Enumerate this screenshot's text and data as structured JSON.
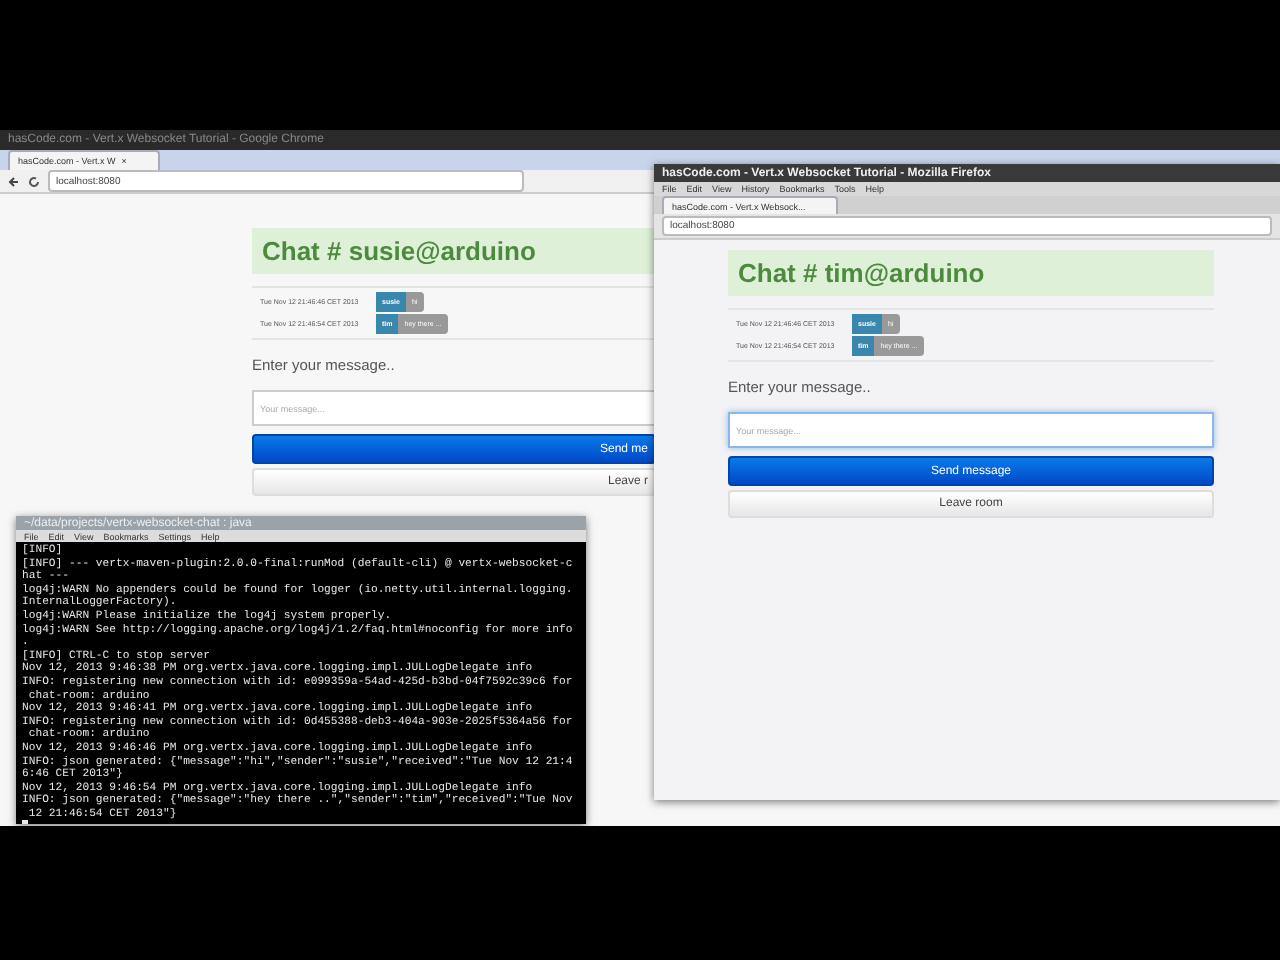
{
  "chrome_window": {
    "title": "hasCode.com - Vert.x Websocket Tutorial - Google Chrome",
    "tab": {
      "label": "hasCode.com - Vert.x W",
      "close": "×"
    },
    "address": "localhost:8080",
    "chat": {
      "heading": "Chat # susie@arduino",
      "messages": [
        {
          "time": "Tue Nov 12 21:46:46 CET 2013",
          "sender": "susie",
          "text": "hi"
        },
        {
          "time": "Tue Nov 12 21:46:54 CET 2013",
          "sender": "tim",
          "text": "hey there ..."
        }
      ],
      "prompt": "Enter your message..",
      "input": {
        "placeholder": "Your message..."
      },
      "send_button": "Send me",
      "leave_button": "Leave r"
    }
  },
  "terminal_window": {
    "title": "~/data/projects/vertx-websocket-chat : java",
    "menu": [
      "File",
      "Edit",
      "View",
      "Bookmarks",
      "Settings",
      "Help"
    ],
    "lines": [
      "[INFO]",
      "[INFO] --- vertx-maven-plugin:2.0.0-final:runMod (default-cli) @ vertx-websocket-c",
      "hat ---",
      "log4j:WARN No appenders could be found for logger (io.netty.util.internal.logging.",
      "InternalLoggerFactory).",
      "log4j:WARN Please initialize the log4j system properly.",
      "log4j:WARN See http://logging.apache.org/log4j/1.2/faq.html#noconfig for more info",
      ".",
      "[INFO] CTRL-C to stop server",
      "Nov 12, 2013 9:46:38 PM org.vertx.java.core.logging.impl.JULLogDelegate info",
      "INFO: registering new connection with id: e099359a-54ad-425d-b3bd-04f7592c39c6 for",
      " chat-room: arduino",
      "Nov 12, 2013 9:46:41 PM org.vertx.java.core.logging.impl.JULLogDelegate info",
      "INFO: registering new connection with id: 0d455388-deb3-404a-903e-2025f5364a56 for",
      " chat-room: arduino",
      "Nov 12, 2013 9:46:46 PM org.vertx.java.core.logging.impl.JULLogDelegate info",
      "INFO: json generated: {\"message\":\"hi\",\"sender\":\"susie\",\"received\":\"Tue Nov 12 21:4",
      "6:46 CET 2013\"}",
      "Nov 12, 2013 9:46:54 PM org.vertx.java.core.logging.impl.JULLogDelegate info",
      "INFO: json generated: {\"message\":\"hey there ..\",\"sender\":\"tim\",\"received\":\"Tue Nov",
      " 12 21:46:54 CET 2013\"}"
    ]
  },
  "firefox_window": {
    "title": "hasCode.com - Vert.x Websocket Tutorial - Mozilla Firefox",
    "menu": [
      "File",
      "Edit",
      "View",
      "History",
      "Bookmarks",
      "Tools",
      "Help"
    ],
    "tab": {
      "label": "hasCode.com - Vert.x Websock..."
    },
    "address": "localhost:8080",
    "chat": {
      "heading": "Chat # tim@arduino",
      "messages": [
        {
          "time": "Tue Nov 12 21:46:46 CET 2013",
          "sender": "susie",
          "text": "hi"
        },
        {
          "time": "Tue Nov 12 21:46:54 CET 2013",
          "sender": "tim",
          "text": "hey there ..."
        }
      ],
      "prompt": "Enter your message..",
      "input": {
        "placeholder": "Your message..."
      },
      "send_button": "Send message",
      "leave_button": "Leave room"
    }
  }
}
